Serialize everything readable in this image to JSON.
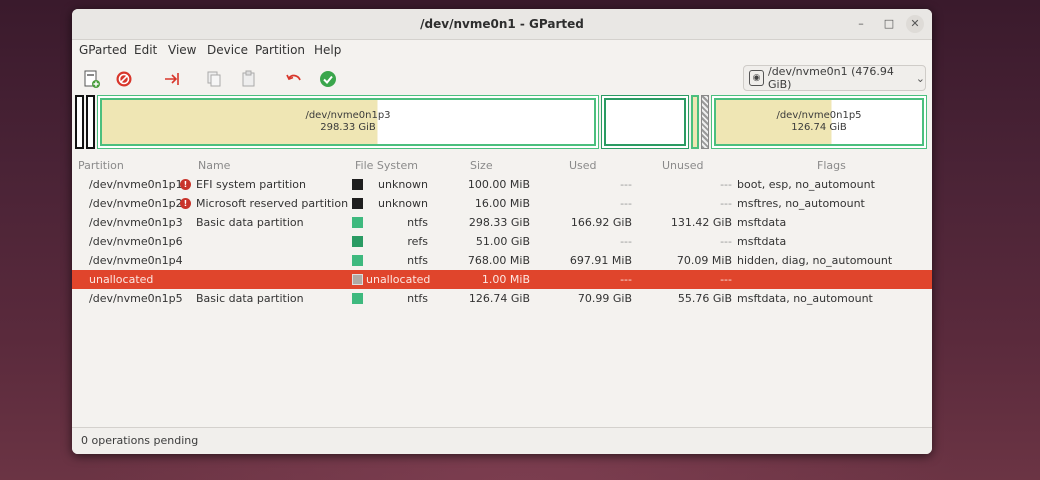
{
  "window": {
    "title": "/dev/nvme0n1 - GParted"
  },
  "window_controls": {
    "minimize": "–",
    "maximize": "□",
    "close": "✕"
  },
  "menu": [
    "GParted",
    "Edit",
    "View",
    "Device",
    "Partition",
    "Help"
  ],
  "toolbar": {
    "icons": [
      "new-partition-icon",
      "delete-icon",
      "resize-move-icon",
      "copy-icon",
      "paste-icon",
      "undo-icon",
      "apply-icon"
    ],
    "device_selector": "/dev/nvme0n1 (476.94 GiB)",
    "device_chevron": "⌄"
  },
  "disk_map": {
    "p3_name": "/dev/nvme0n1p3",
    "p3_size": "298.33 GiB",
    "p5_name": "/dev/nvme0n1p5",
    "p5_size": "126.74 GiB"
  },
  "columns": [
    "Partition",
    "Name",
    "File System",
    "Size",
    "Used",
    "Unused",
    "Flags"
  ],
  "rows": [
    {
      "partition": "/dev/nvme0n1p1",
      "warn": "!",
      "name": "EFI system partition",
      "fs_color": "#1e1e1e",
      "fs": "unknown",
      "size": "100.00 MiB",
      "used": "---",
      "unused": "---",
      "flags": "boot, esp, no_automount"
    },
    {
      "partition": "/dev/nvme0n1p2",
      "warn": "!",
      "name": "Microsoft reserved partition",
      "fs_color": "#1e1e1e",
      "fs": "unknown",
      "size": "16.00 MiB",
      "used": "---",
      "unused": "---",
      "flags": "msftres, no_automount"
    },
    {
      "partition": "/dev/nvme0n1p3",
      "warn": "",
      "name": "Basic data partition",
      "fs_color": "#3eb97e",
      "fs": "ntfs",
      "size": "298.33 GiB",
      "used": "166.92 GiB",
      "unused": "131.42 GiB",
      "flags": "msftdata"
    },
    {
      "partition": "/dev/nvme0n1p6",
      "warn": "",
      "name": "",
      "fs_color": "#2a9b63",
      "fs": "refs",
      "size": "51.00 GiB",
      "used": "---",
      "unused": "---",
      "flags": "msftdata"
    },
    {
      "partition": "/dev/nvme0n1p4",
      "warn": "",
      "name": "",
      "fs_color": "#3eb97e",
      "fs": "ntfs",
      "size": "768.00 MiB",
      "used": "697.91 MiB",
      "unused": "70.09 MiB",
      "flags": "hidden, diag, no_automount"
    },
    {
      "partition": "unallocated",
      "warn": "",
      "name": "",
      "fs_color": "#b0aaa5",
      "fs": "unallocated",
      "size": "1.00 MiB",
      "used": "---",
      "unused": "---",
      "flags": ""
    },
    {
      "partition": "/dev/nvme0n1p5",
      "warn": "",
      "name": "Basic data partition",
      "fs_color": "#3eb97e",
      "fs": "ntfs",
      "size": "126.74 GiB",
      "used": "70.99 GiB",
      "unused": "55.76 GiB",
      "flags": "msftdata, no_automount"
    }
  ],
  "status": "0 operations pending"
}
